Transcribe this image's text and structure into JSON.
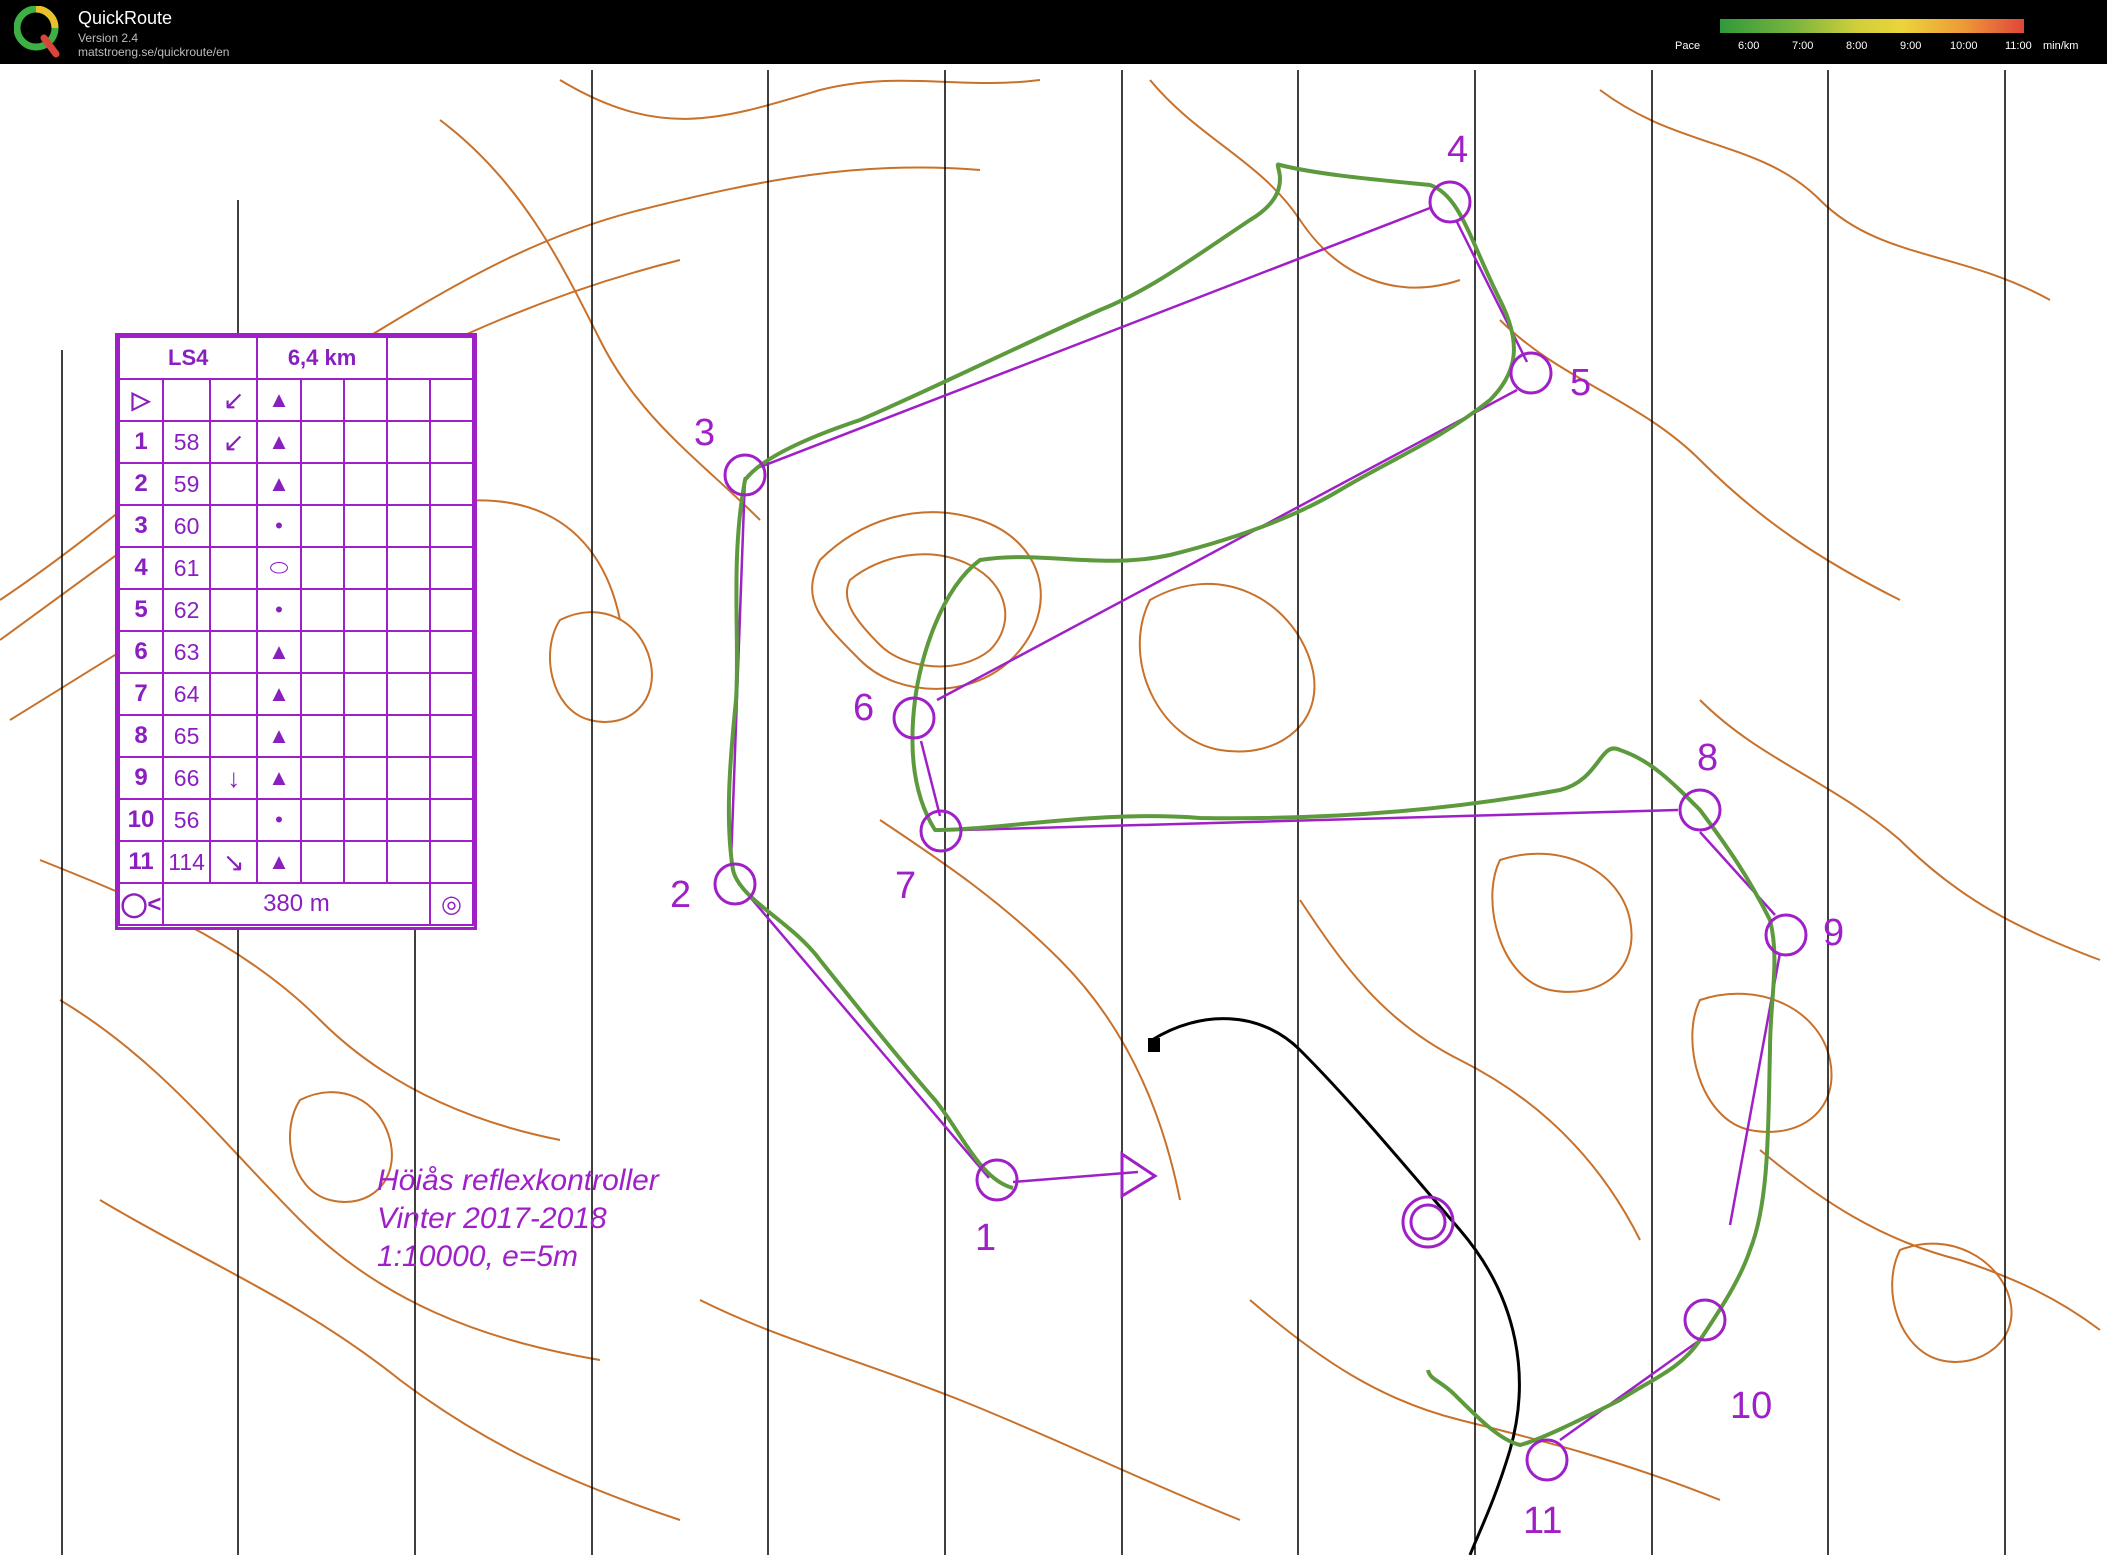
{
  "app": {
    "title": "QuickRoute",
    "version": "Version 2.4",
    "url": "matstroeng.se/quickroute/en"
  },
  "pace": {
    "label": "Pace",
    "ticks": [
      "6:00",
      "7:00",
      "8:00",
      "9:00",
      "10:00",
      "11:00"
    ],
    "unit": "min/km",
    "colors": [
      "#2f9a3a",
      "#6ab23e",
      "#b6c93a",
      "#e9d83a",
      "#ee9a38",
      "#e04a3a"
    ]
  },
  "legend": {
    "course": "LS4",
    "distance": "6,4 km",
    "start_symbol": "▷",
    "start_dir": "↙",
    "start_feature": "▲",
    "rows": [
      {
        "n": "1",
        "code": "58",
        "dir": "↙",
        "feature": "▲"
      },
      {
        "n": "2",
        "code": "59",
        "dir": "",
        "feature": "▲"
      },
      {
        "n": "3",
        "code": "60",
        "dir": "",
        "feature": "•"
      },
      {
        "n": "4",
        "code": "61",
        "dir": "",
        "feature": "⬭"
      },
      {
        "n": "5",
        "code": "62",
        "dir": "",
        "feature": "•"
      },
      {
        "n": "6",
        "code": "63",
        "dir": "",
        "feature": "▲"
      },
      {
        "n": "7",
        "code": "64",
        "dir": "",
        "feature": "▲"
      },
      {
        "n": "8",
        "code": "65",
        "dir": "",
        "feature": "▲"
      },
      {
        "n": "9",
        "code": "66",
        "dir": "↓",
        "feature": "▲"
      },
      {
        "n": "10",
        "code": "56",
        "dir": "",
        "feature": "•"
      },
      {
        "n": "11",
        "code": "114",
        "dir": "↘",
        "feature": "▲"
      }
    ],
    "finish_distance": "380 m"
  },
  "map_text": {
    "line1": "Höiås reflexkontroller",
    "line2": "Vinter 2017-2018",
    "line3": "1:10000, e=5m"
  },
  "controls": [
    "1",
    "2",
    "3",
    "4",
    "5",
    "6",
    "7",
    "8",
    "9",
    "10",
    "11"
  ],
  "colors": {
    "course": "#a020c8",
    "contour": "#c8712a",
    "route": "#5d9a3d"
  }
}
